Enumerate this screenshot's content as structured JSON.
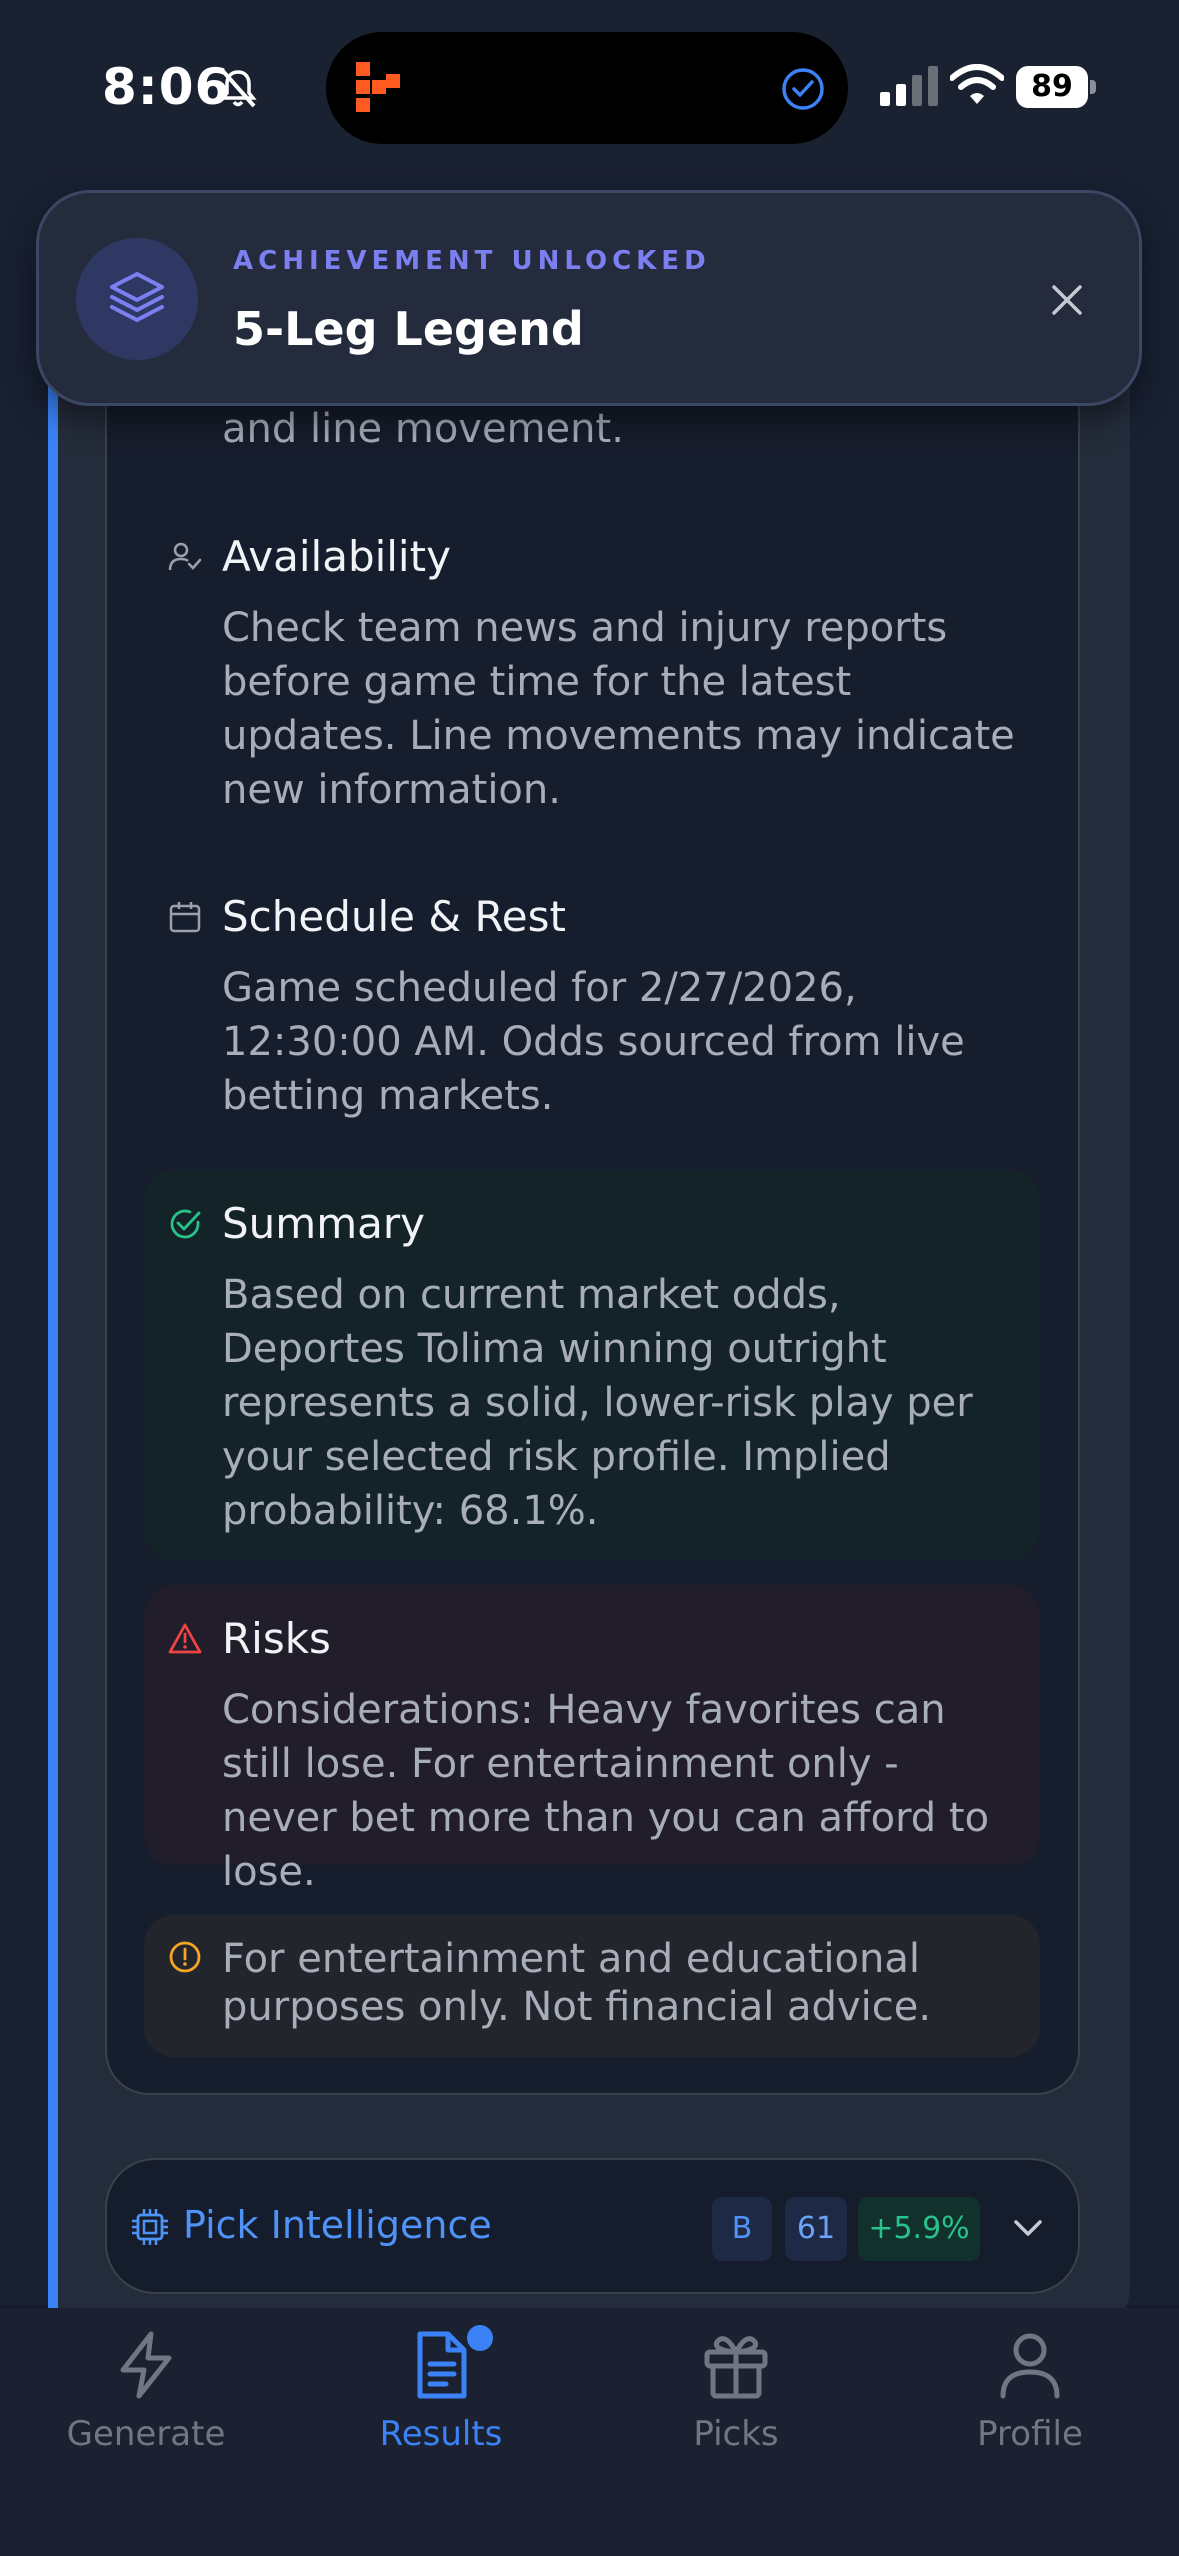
{
  "status_bar": {
    "time": "8:06",
    "battery": "89"
  },
  "toast": {
    "kicker": "ACHIEVEMENT UNLOCKED",
    "title": "5-Leg Legend",
    "icon": "layers-icon",
    "accent_color": "#7c7ff0"
  },
  "analysis": {
    "clipped_text": "and line movement.",
    "sections": [
      {
        "title": "Availability",
        "icon": "user-check-icon",
        "body": "Check team news and injury reports before game time for the latest updates. Line movements may indicate new information."
      },
      {
        "title": "Schedule & Rest",
        "icon": "calendar-icon",
        "body": "Game scheduled for 2/27/2026, 12:30:00 AM. Odds sourced from live betting markets."
      },
      {
        "title": "Summary",
        "icon": "check-circle-icon",
        "body": "Based on current market odds, Deportes Tolima winning outright represents a solid, lower-risk play per your selected risk profile. Implied probability: 68.1%."
      },
      {
        "title": "Risks",
        "icon": "warning-icon",
        "body": "Considerations: Heavy favorites can still lose. For entertainment only - never bet more than you can afford to lose."
      }
    ],
    "disclaimer": "For entertainment and educational purposes only. Not financial advice."
  },
  "pick_intelligence": {
    "label": "Pick Intelligence",
    "grade": "B",
    "score": "61",
    "edge": "+5.9%"
  },
  "nav": {
    "items": [
      {
        "label": "Generate",
        "icon": "bolt-icon"
      },
      {
        "label": "Results",
        "icon": "document-icon",
        "active": true
      },
      {
        "label": "Picks",
        "icon": "gift-icon"
      },
      {
        "label": "Profile",
        "icon": "user-icon"
      }
    ],
    "active_color": "#3b82f6",
    "inactive_color": "#6f7684"
  }
}
